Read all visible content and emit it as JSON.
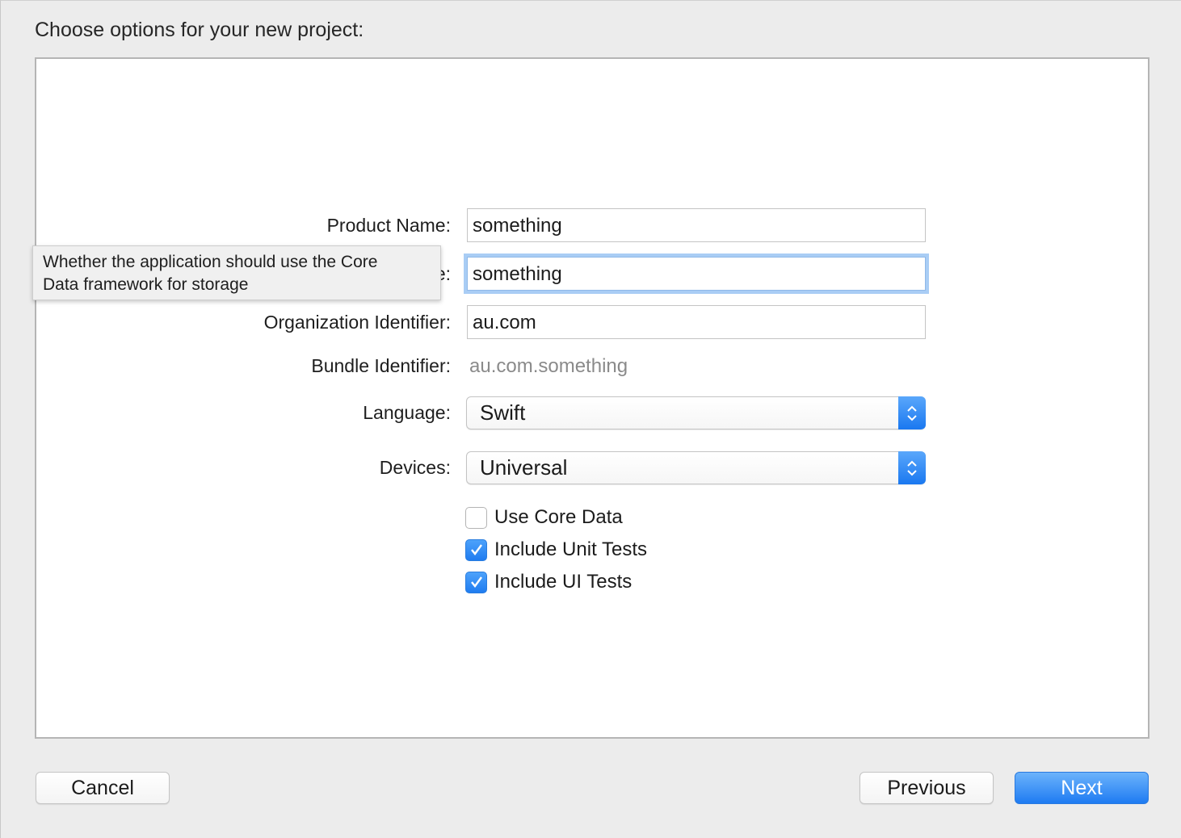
{
  "header": {
    "title": "Choose options for your new project:"
  },
  "form": {
    "product_name": {
      "label": "Product Name:",
      "value": "something"
    },
    "organization_name": {
      "label_visible_fragment": "e:",
      "value": "something"
    },
    "organization_identifier": {
      "label": "Organization Identifier:",
      "value": "au.com"
    },
    "bundle_identifier": {
      "label": "Bundle Identifier:",
      "value": "au.com.something"
    },
    "language": {
      "label": "Language:",
      "value": "Swift"
    },
    "devices": {
      "label": "Devices:",
      "value": "Universal"
    },
    "checkboxes": [
      {
        "label": "Use Core Data",
        "checked": false
      },
      {
        "label": "Include Unit Tests",
        "checked": true
      },
      {
        "label": "Include UI Tests",
        "checked": true
      }
    ]
  },
  "tooltip": {
    "line1": "Whether the application should use the Core",
    "line2": "Data framework for storage"
  },
  "footer": {
    "cancel_label": "Cancel",
    "previous_label": "Previous",
    "next_label": "Next"
  },
  "colors": {
    "accent": "#1f7cf0",
    "focus_ring": "#a9cdf5",
    "panel_bg": "#ffffff",
    "window_bg": "#ececec"
  }
}
